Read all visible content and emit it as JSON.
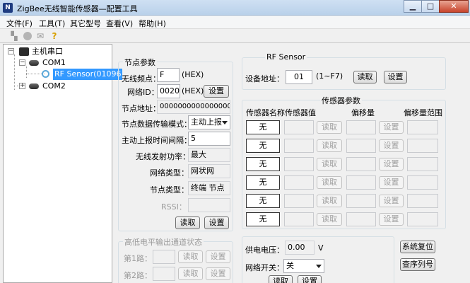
{
  "window": {
    "icon_text": "N",
    "title": "ZigBee无线智能传感器—配置工具",
    "minimize_glyph": "▁",
    "maximize_glyph": "□",
    "close_glyph": "✕"
  },
  "menu": [
    "文件(F)",
    "工具(T)",
    "其它型号",
    "查看(V)",
    "帮助(H)"
  ],
  "toolbar": {
    "icons": [
      "open-port-icon",
      "stop-icon",
      "send-icon",
      "help-icon"
    ],
    "help_glyph": "?"
  },
  "tree": {
    "root": {
      "label": "主机串口",
      "expander": "−"
    },
    "com1": {
      "label": "COM1",
      "expander": "−"
    },
    "sensor": {
      "label": "RF Sensor(01096"
    },
    "com2": {
      "label": "COM2",
      "expander": "+"
    }
  },
  "node_params": {
    "title": "节点参数",
    "frequency": {
      "label": "无线频点：",
      "value": "F",
      "unit": "(HEX)"
    },
    "network_id": {
      "label": "网络ID：",
      "value": "0020",
      "unit": "(HEX)",
      "button": "设置"
    },
    "address": {
      "label": "节点地址：",
      "value": "0000000000000000"
    },
    "transfer_mode": {
      "label": "节点数据传输模式：",
      "value": "主动上报"
    },
    "report_interval": {
      "label": "主动上报时间间隔：",
      "value": "5"
    },
    "tx_power": {
      "label": "无线发射功率：",
      "value": "最大"
    },
    "network_type": {
      "label": "网络类型：",
      "value": "网状网"
    },
    "node_type": {
      "label": "节点类型：",
      "value": "终端 节点"
    },
    "rssi": {
      "label": "RSSI：",
      "value": ""
    },
    "read_button": "读取",
    "set_button": "设置"
  },
  "rf_sensor": {
    "title": "RF Sensor",
    "device_address": {
      "label": "设备地址：",
      "value": "01",
      "range": "(1~F7)",
      "read": "读取",
      "set": "设置"
    }
  },
  "sensor_params": {
    "title": "传感器参数",
    "headers": [
      "传感器名称",
      "传感器值",
      "偏移量",
      "偏移量范围"
    ],
    "rows": [
      {
        "name": "无",
        "read": "读取",
        "set": "设置"
      },
      {
        "name": "无",
        "read": "读取",
        "set": "设置"
      },
      {
        "name": "无",
        "read": "读取",
        "set": "设置"
      },
      {
        "name": "无",
        "read": "读取",
        "set": "设置"
      },
      {
        "name": "无",
        "read": "读取",
        "set": "设置"
      },
      {
        "name": "无",
        "read": "读取",
        "set": "设置"
      }
    ]
  },
  "io_status": {
    "title": "高低电平输出通道状态",
    "rows": [
      {
        "label": "第1路：",
        "read": "读取",
        "set": "设置"
      },
      {
        "label": "第2路：",
        "read": "读取",
        "set": "设置"
      }
    ]
  },
  "power": {
    "voltage_label": "供电电压：",
    "voltage_value": "0.00",
    "voltage_unit": "V",
    "network_switch_label": "网络开关：",
    "network_switch_value": "关",
    "read_button": "读取",
    "set_button": "设置"
  },
  "system": {
    "reset_button": "系统复位",
    "serial_button": "查序列号"
  }
}
